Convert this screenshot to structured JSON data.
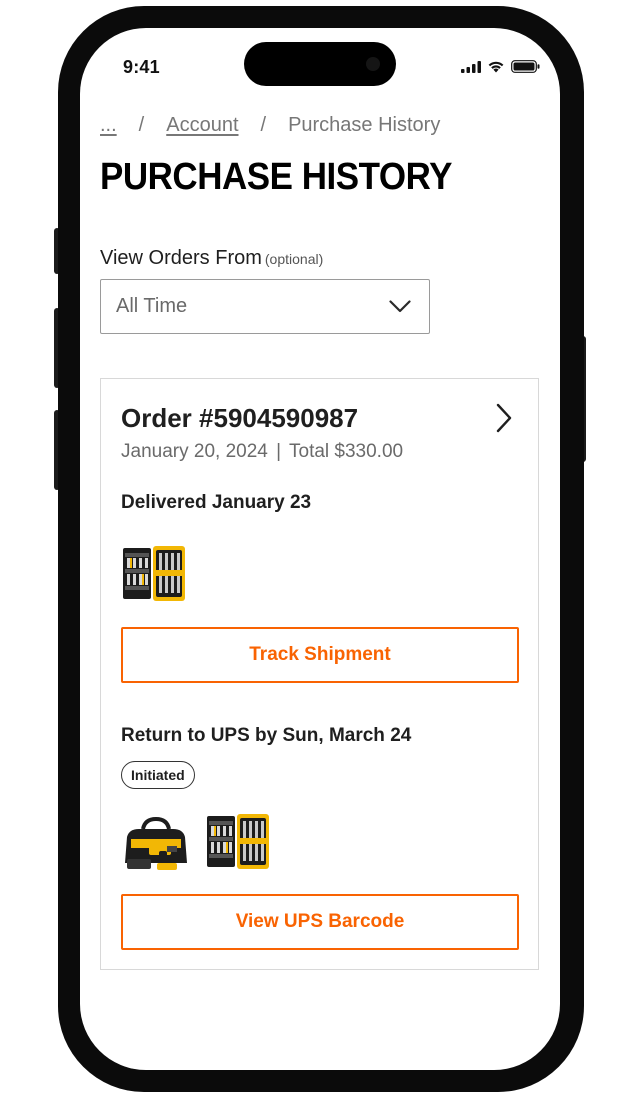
{
  "status_bar": {
    "time": "9:41"
  },
  "breadcrumb": {
    "ellipsis": "...",
    "separator": "/",
    "account": "Account",
    "current": "Purchase History"
  },
  "page_title": "PURCHASE HISTORY",
  "filter": {
    "label": "View Orders From",
    "optional": "(optional)",
    "selected": "All Time"
  },
  "order": {
    "number": "Order #5904590987",
    "date": "January 20, 2024",
    "separator": "|",
    "total": "Total $330.00",
    "delivered": "Delivered January 23",
    "track_button": "Track Shipment",
    "return_title": "Return to UPS by Sun, March 24",
    "return_status": "Initiated",
    "barcode_button": "View UPS Barcode"
  },
  "colors": {
    "accent": "#f96302",
    "dewalt_yellow": "#f2b705",
    "text": "#1f1f1f",
    "muted": "#6a6a6a"
  },
  "icons": [
    "signal-icon",
    "wifi-icon",
    "battery-icon",
    "chevron-down-icon",
    "chevron-right-icon"
  ]
}
